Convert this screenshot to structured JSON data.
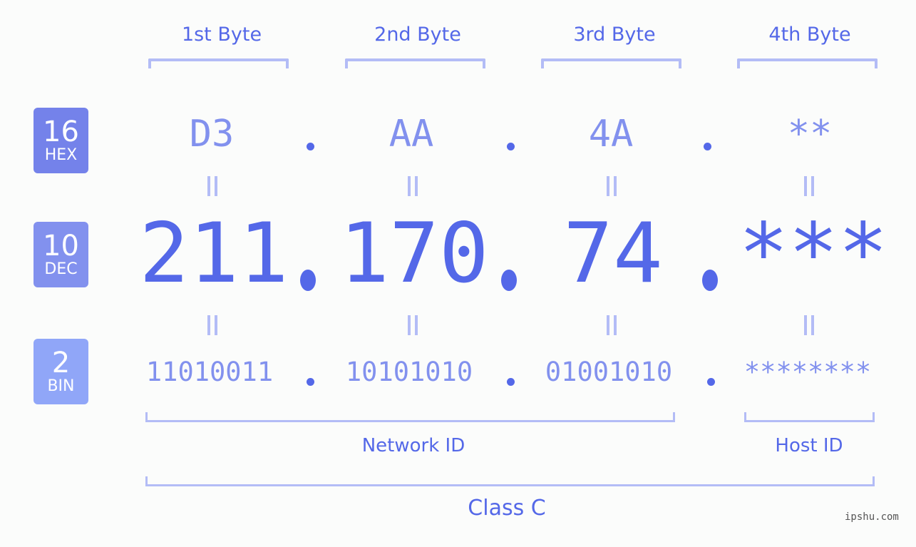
{
  "bytes": [
    {
      "label": "1st Byte",
      "hex": "D3",
      "dec": "211",
      "bin": "11010011"
    },
    {
      "label": "2nd Byte",
      "hex": "AA",
      "dec": "170",
      "bin": "10101010"
    },
    {
      "label": "3rd Byte",
      "hex": "4A",
      "dec": "74",
      "bin": "01001010"
    },
    {
      "label": "4th Byte",
      "hex": "**",
      "dec": "***",
      "bin": "********"
    }
  ],
  "bases": [
    {
      "num": "16",
      "label": "HEX",
      "color": "#7482ea"
    },
    {
      "num": "10",
      "label": "DEC",
      "color": "#8291ee"
    },
    {
      "num": "2",
      "label": "BIN",
      "color": "#90a6f8"
    }
  ],
  "groups": {
    "network": "Network ID",
    "host": "Host ID",
    "class": "Class C"
  },
  "colors": {
    "accent": "#5468e8",
    "secondary": "#8291ee",
    "bracket": "#b3bcf6"
  },
  "watermark": "ipshu.com"
}
